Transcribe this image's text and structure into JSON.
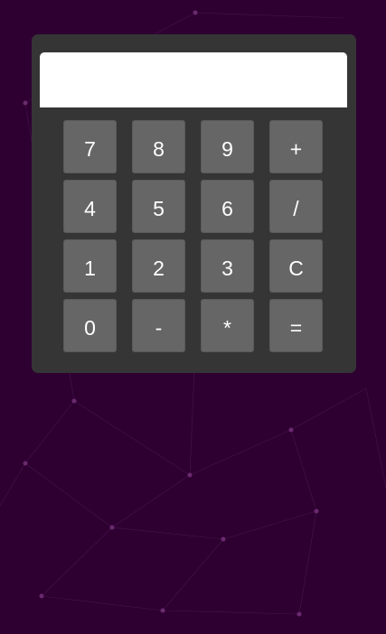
{
  "display": {
    "value": ""
  },
  "keypad": {
    "keys": [
      {
        "label": "7",
        "name": "key-7"
      },
      {
        "label": "8",
        "name": "key-8"
      },
      {
        "label": "9",
        "name": "key-9"
      },
      {
        "label": "+",
        "name": "key-add"
      },
      {
        "label": "4",
        "name": "key-4"
      },
      {
        "label": "5",
        "name": "key-5"
      },
      {
        "label": "6",
        "name": "key-6"
      },
      {
        "label": "/",
        "name": "key-divide"
      },
      {
        "label": "1",
        "name": "key-1"
      },
      {
        "label": "2",
        "name": "key-2"
      },
      {
        "label": "3",
        "name": "key-3"
      },
      {
        "label": "C",
        "name": "key-clear"
      },
      {
        "label": "0",
        "name": "key-0"
      },
      {
        "label": "-",
        "name": "key-subtract"
      },
      {
        "label": "*",
        "name": "key-multiply"
      },
      {
        "label": "=",
        "name": "key-equals"
      }
    ]
  },
  "colors": {
    "page_background": "#2e0032",
    "calculator_body": "#353535",
    "key_background": "#666666",
    "key_text": "#ffffff",
    "display_background": "#ffffff"
  }
}
